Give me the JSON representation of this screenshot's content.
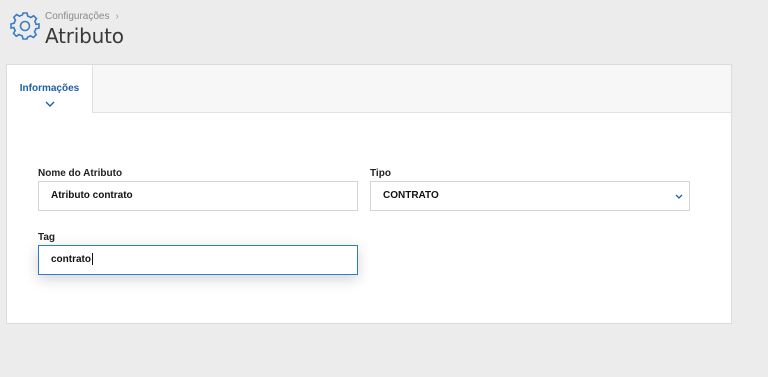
{
  "header": {
    "breadcrumb": "Configurações",
    "title": "Atributo"
  },
  "tabs": [
    {
      "label": "Informações",
      "active": true
    }
  ],
  "form": {
    "name": {
      "label": "Nome do Atributo",
      "value": "Atributo contrato"
    },
    "type": {
      "label": "Tipo",
      "value": "CONTRATO"
    },
    "tag": {
      "label": "Tag",
      "value": "contrato"
    }
  },
  "colors": {
    "accent": "#1f5fa8",
    "focus_border": "#2f7dd1",
    "background": "#ececec"
  }
}
